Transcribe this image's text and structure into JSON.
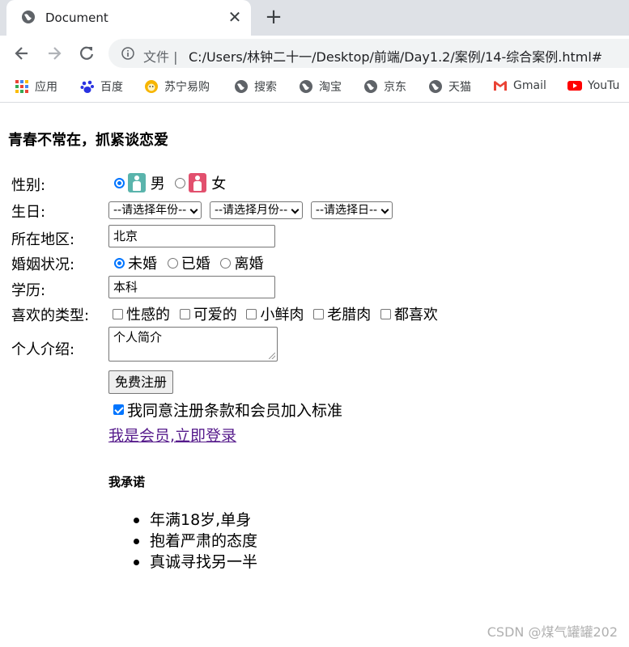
{
  "browser": {
    "tab_title": "Document",
    "tab_close": "✕",
    "new_tab": "+",
    "address_prefix": "文件",
    "address_url": "C:/Users/林钟二十一/Desktop/前端/Day1.2/案例/14-综合案例.html#",
    "bookmarks": [
      "应用",
      "百度",
      "苏宁易购",
      "搜索",
      "淘宝",
      "京东",
      "天猫",
      "Gmail",
      "YouTu"
    ]
  },
  "page": {
    "title": "青春不常在，抓紧谈恋爱",
    "labels": {
      "gender": "性别:",
      "birthday": "生日:",
      "region": "所在地区:",
      "marriage": "婚姻状况:",
      "education": "学历:",
      "types": "喜欢的类型:",
      "intro": "个人介绍:"
    },
    "gender_options": [
      "男",
      "女"
    ],
    "birthday_selects": [
      "--请选择年份--",
      "--请选择月份--",
      "--请选择日--"
    ],
    "region_value": "北京",
    "marriage_options": [
      "未婚",
      "已婚",
      "离婚"
    ],
    "education_value": "本科",
    "type_options": [
      "性感的",
      "可爱的",
      "小鲜肉",
      "老腊肉",
      "都喜欢"
    ],
    "intro_placeholder": "个人简介",
    "register_button": "免费注册",
    "agree_text": "我同意注册条款和会员加入标准",
    "login_link": "我是会员,立即登录",
    "promise_title": "我承诺",
    "promises": [
      "年满18岁,单身",
      "抱着严肃的态度",
      "真诚寻找另一半"
    ]
  },
  "watermark": "CSDN @煤气罐罐202"
}
